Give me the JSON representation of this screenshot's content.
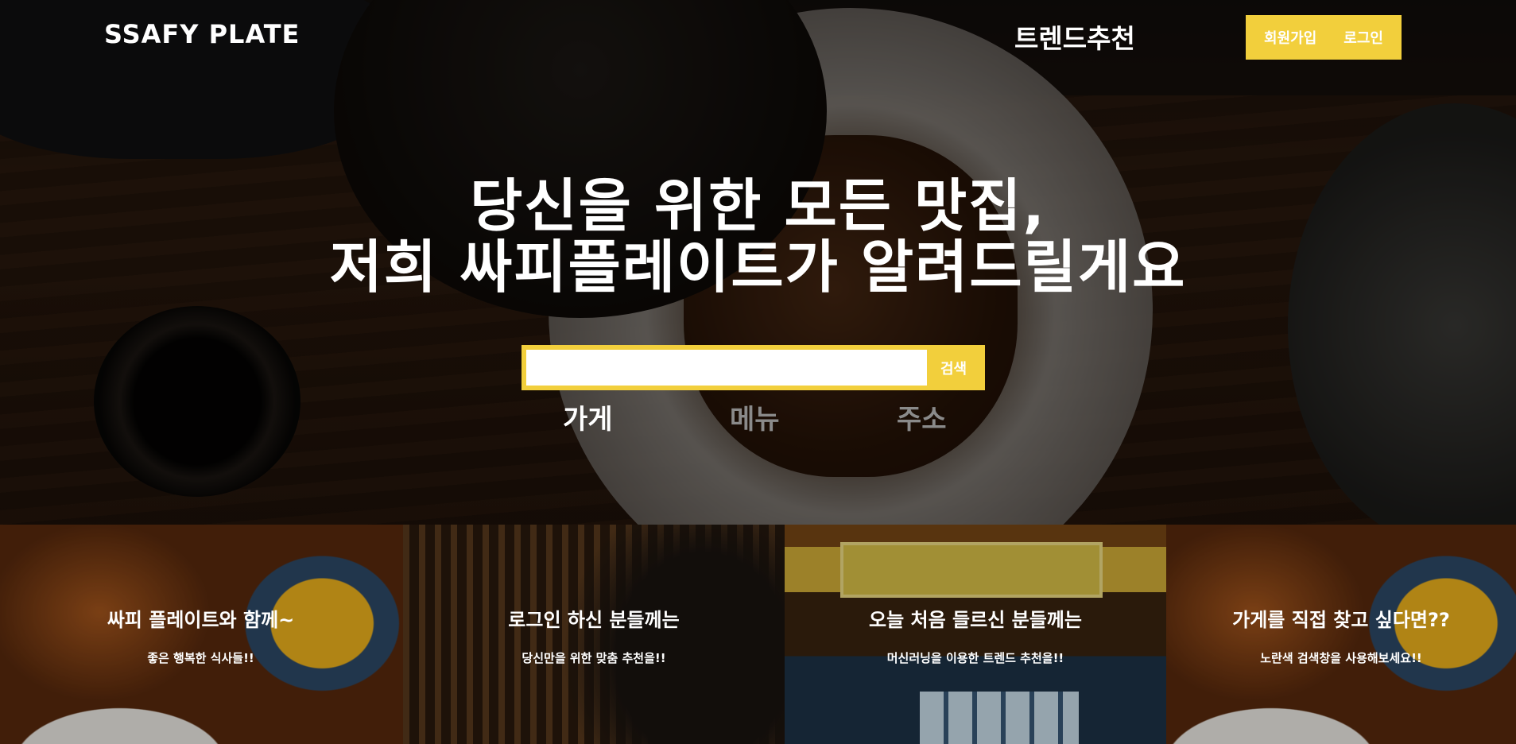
{
  "header": {
    "logo": "SSAFY PLATE",
    "nav_trend": "트렌드추천",
    "signup_label": "회원가입",
    "login_label": "로그인"
  },
  "hero": {
    "headline_line1": "당신을 위한 모든 맛집,",
    "headline_line2": "저희 싸피플레이트가 알려드릴게요"
  },
  "search": {
    "input_value": "",
    "button_label": "검색",
    "tabs": [
      {
        "label": "가게",
        "active": true
      },
      {
        "label": "메뉴",
        "active": false
      },
      {
        "label": "주소",
        "active": false
      }
    ]
  },
  "cards": [
    {
      "title": "싸피 플레이트와 함께~",
      "subtitle": "좋은 행복한 식사들!!"
    },
    {
      "title": "로그인 하신 분들께는",
      "subtitle": "당신만을 위한 맞춤 추천을!!"
    },
    {
      "title": "오늘 처음 들르신 분들께는",
      "subtitle": "머신러닝을 이용한 트렌드 추천을!!"
    },
    {
      "title": "가게를 직접 찾고 싶다면??",
      "subtitle": "노란색 검색창을 사용해보세요!!"
    }
  ],
  "colors": {
    "accent_yellow": "#f2cf3c",
    "inactive_tab": "#8a8a8a"
  }
}
